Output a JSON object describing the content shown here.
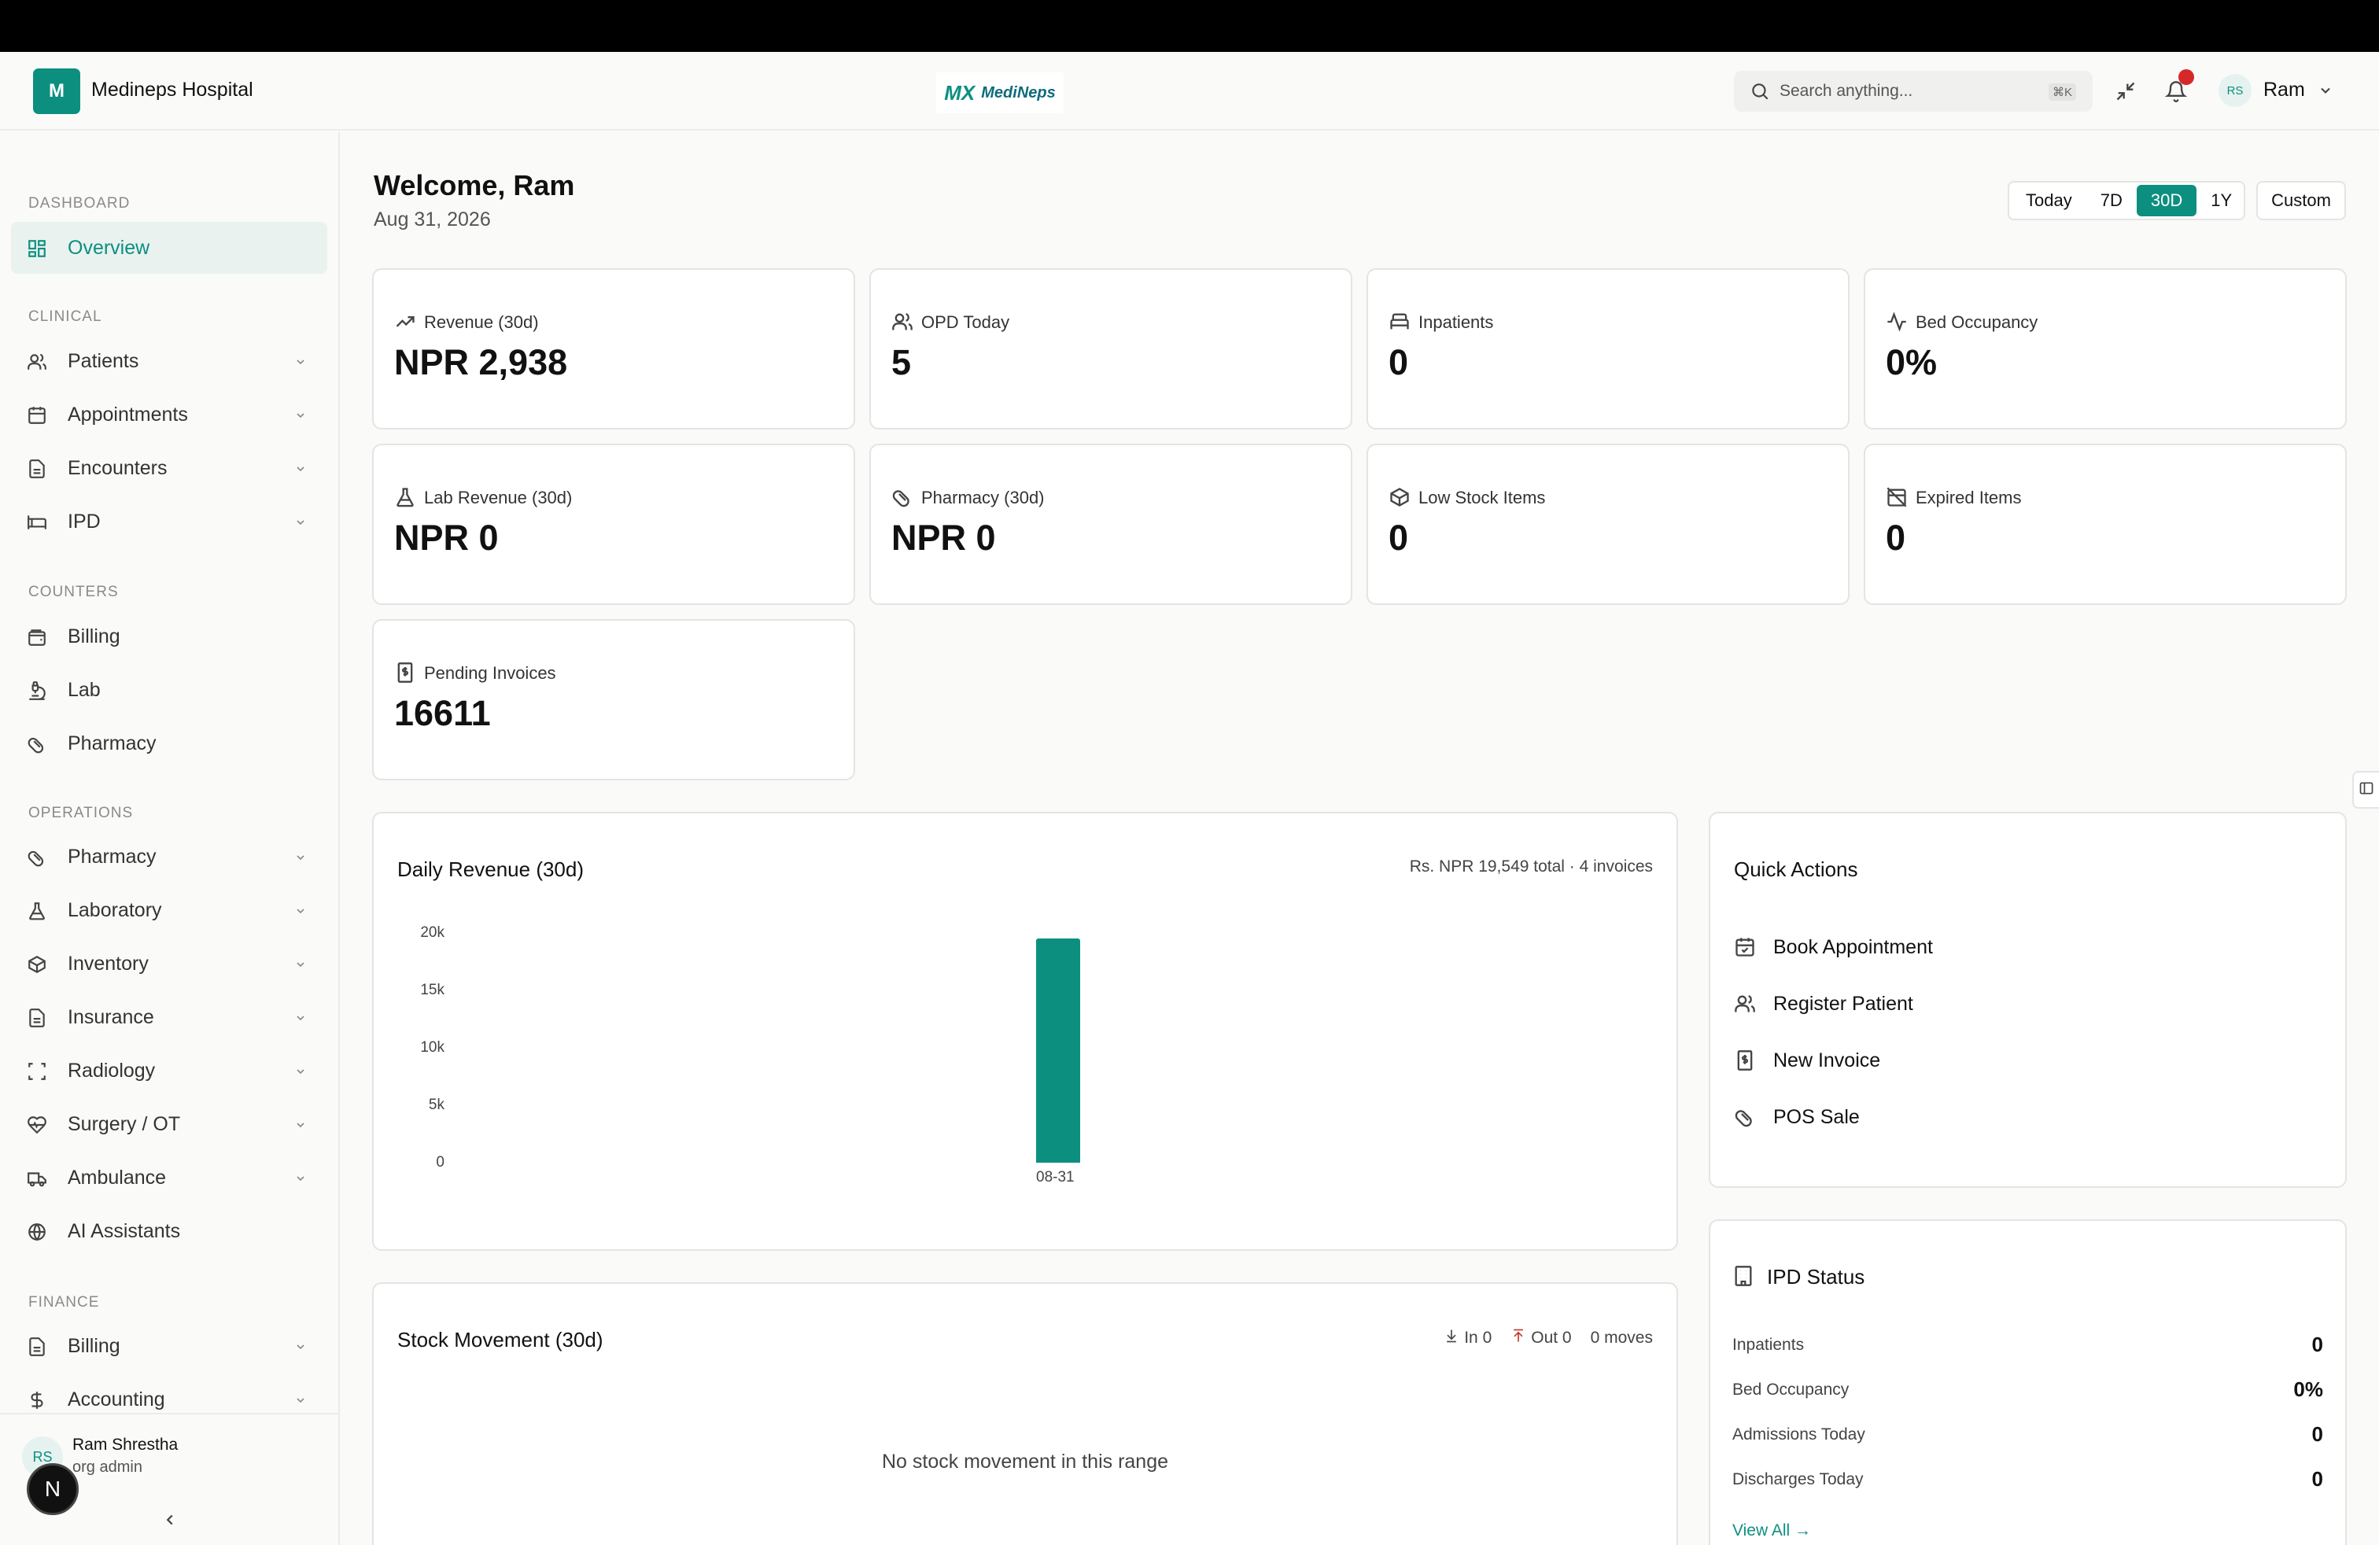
{
  "header": {
    "logo_letter": "M",
    "hospital_name": "Medineps Hospital",
    "brand_mark": "MX",
    "brand_text": "MediNeps",
    "search_placeholder": "Search anything...",
    "search_shortcut": "⌘K",
    "user_initials": "RS",
    "user_name": "Ram"
  },
  "sidebar": {
    "sections": {
      "dashboard": "DASHBOARD",
      "clinical": "CLINICAL",
      "counters": "COUNTERS",
      "operations": "OPERATIONS",
      "finance": "FINANCE"
    },
    "items": {
      "overview": "Overview",
      "patients": "Patients",
      "appointments": "Appointments",
      "encounters": "Encounters",
      "ipd": "IPD",
      "billing_counter": "Billing",
      "lab_counter": "Lab",
      "pharmacy_counter": "Pharmacy",
      "pharmacy": "Pharmacy",
      "laboratory": "Laboratory",
      "inventory": "Inventory",
      "insurance": "Insurance",
      "radiology": "Radiology",
      "surgery": "Surgery / OT",
      "ambulance": "Ambulance",
      "ai_assistants": "AI Assistants",
      "billing": "Billing",
      "accounting": "Accounting"
    },
    "footer": {
      "initials": "RS",
      "name": "Ram Shrestha",
      "role": "org admin",
      "badge": "N"
    }
  },
  "main": {
    "welcome": "Welcome, Ram",
    "date": "Aug 31, 2026",
    "ranges": {
      "today": "Today",
      "d7": "7D",
      "d30": "30D",
      "y1": "1Y",
      "selected": "30D"
    },
    "custom": "Custom",
    "stats": {
      "revenue": {
        "label": "Revenue (30d)",
        "value": "NPR 2,938"
      },
      "opd": {
        "label": "OPD Today",
        "value": "5"
      },
      "inpatients": {
        "label": "Inpatients",
        "value": "0"
      },
      "bed": {
        "label": "Bed Occupancy",
        "value": "0%"
      },
      "lab": {
        "label": "Lab Revenue (30d)",
        "value": "NPR 0"
      },
      "pharmacy": {
        "label": "Pharmacy (30d)",
        "value": "NPR 0"
      },
      "lowstock": {
        "label": "Low Stock Items",
        "value": "0"
      },
      "expired": {
        "label": "Expired Items",
        "value": "0"
      },
      "pending": {
        "label": "Pending Invoices",
        "value": "16611"
      }
    },
    "daily_revenue": {
      "title": "Daily Revenue (30d)",
      "summary": "Rs. NPR 19,549 total · 4 invoices"
    },
    "quick_actions": {
      "title": "Quick Actions",
      "book": "Book Appointment",
      "register": "Register Patient",
      "invoice": "New Invoice",
      "pos": "POS Sale"
    },
    "ipd_status": {
      "title": "IPD Status",
      "inpatients_label": "Inpatients",
      "inpatients_value": "0",
      "bed_label": "Bed Occupancy",
      "bed_value": "0%",
      "admissions_label": "Admissions Today",
      "admissions_value": "0",
      "discharges_label": "Discharges Today",
      "discharges_value": "0",
      "view_all": "View All →"
    },
    "stock_movement": {
      "title": "Stock Movement (30d)",
      "in": "In 0",
      "out": "Out 0",
      "moves": "0 moves",
      "empty": "No stock movement in this range"
    }
  },
  "colors": {
    "accent": "#0d8f80",
    "notification": "#d62828"
  },
  "chart_data": {
    "type": "bar",
    "categories": [
      "08-31"
    ],
    "values": [
      19549
    ],
    "title": "Daily Revenue (30d)",
    "xlabel": "",
    "ylabel": "",
    "ylim": [
      0,
      20000
    ],
    "yticks": [
      "20k",
      "15k",
      "10k",
      "5k",
      "0"
    ]
  }
}
